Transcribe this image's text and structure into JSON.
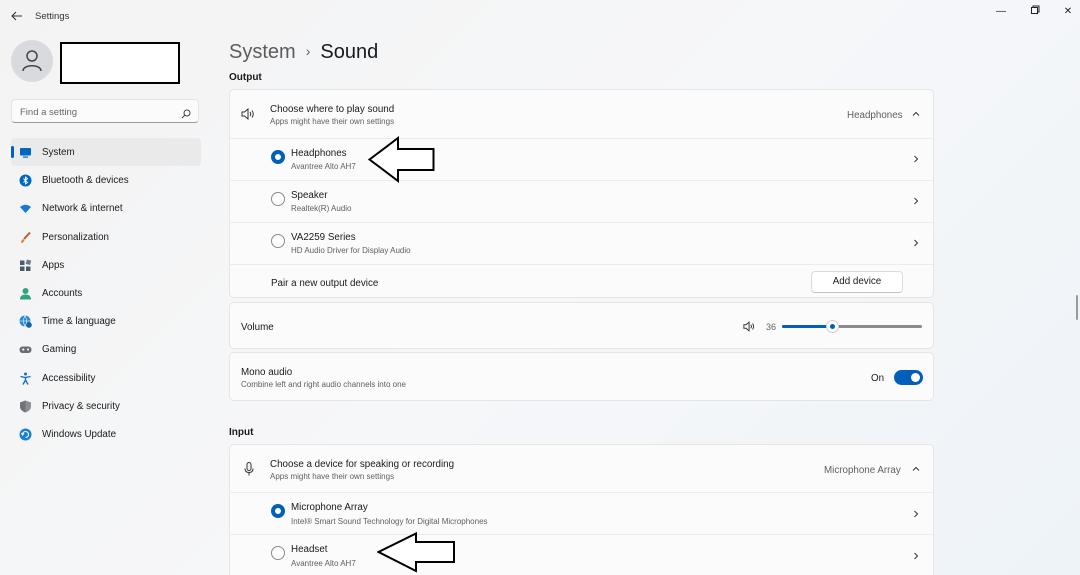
{
  "window": {
    "title": "Settings",
    "back_icon": "back-arrow-icon"
  },
  "sidebar": {
    "search_placeholder": "Find a setting",
    "items": [
      {
        "label": "System",
        "icon": "system-icon",
        "active": true
      },
      {
        "label": "Bluetooth & devices",
        "icon": "bluetooth-icon"
      },
      {
        "label": "Network & internet",
        "icon": "wifi-icon"
      },
      {
        "label": "Personalization",
        "icon": "brush-icon"
      },
      {
        "label": "Apps",
        "icon": "apps-icon"
      },
      {
        "label": "Accounts",
        "icon": "person-icon"
      },
      {
        "label": "Time & language",
        "icon": "globe-clock-icon"
      },
      {
        "label": "Gaming",
        "icon": "gamepad-icon"
      },
      {
        "label": "Accessibility",
        "icon": "accessibility-icon"
      },
      {
        "label": "Privacy & security",
        "icon": "shield-icon"
      },
      {
        "label": "Windows Update",
        "icon": "update-icon"
      }
    ]
  },
  "breadcrumb": {
    "parent": "System",
    "current": "Sound"
  },
  "output": {
    "section_title": "Output",
    "choose": {
      "title": "Choose where to play sound",
      "subtitle": "Apps might have their own settings",
      "value": "Headphones"
    },
    "devices": [
      {
        "name": "Headphones",
        "driver": "Avantree Alto AH7",
        "selected": true
      },
      {
        "name": "Speaker",
        "driver": "Realtek(R) Audio",
        "selected": false
      },
      {
        "name": "VA2259 Series",
        "driver": "HD Audio Driver for Display Audio",
        "selected": false
      }
    ],
    "pair": {
      "label": "Pair a new output device",
      "button": "Add device"
    },
    "volume": {
      "label": "Volume",
      "value": "36",
      "level": 0.36
    },
    "mono": {
      "title": "Mono audio",
      "subtitle": "Combine left and right audio channels into one",
      "state": "On",
      "on": true
    }
  },
  "input": {
    "section_title": "Input",
    "choose": {
      "title": "Choose a device for speaking or recording",
      "subtitle": "Apps might have their own settings",
      "value": "Microphone Array"
    },
    "devices": [
      {
        "name": "Microphone Array",
        "driver": "Intel® Smart Sound Technology for Digital Microphones",
        "selected": true
      },
      {
        "name": "Headset",
        "driver": "Avantree Alto AH7",
        "selected": false
      }
    ]
  },
  "colors": {
    "accent": "#005fb8",
    "background": "#f3f3f3",
    "card": "#fbfbfb"
  }
}
